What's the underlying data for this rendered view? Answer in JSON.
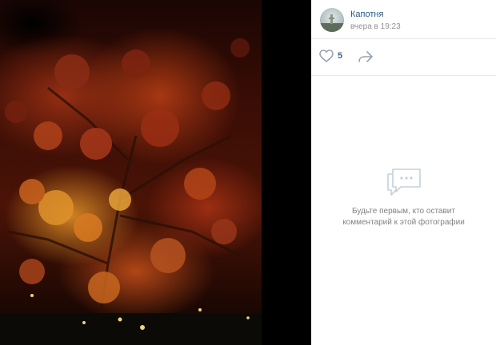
{
  "post": {
    "author": "Капотня",
    "time": "вчера в 19:23"
  },
  "actions": {
    "likes": "5",
    "like_icon": "heart-icon",
    "share_icon": "share-icon"
  },
  "comments": {
    "empty_line1": "Будьте первым, кто оставит",
    "empty_line2": "комментарий к этой фотографии",
    "empty_icon": "comments-icon"
  },
  "colors": {
    "link": "#2a5885",
    "muted": "#939393",
    "icon": "#99a2ad",
    "border": "#e7e8ec"
  }
}
